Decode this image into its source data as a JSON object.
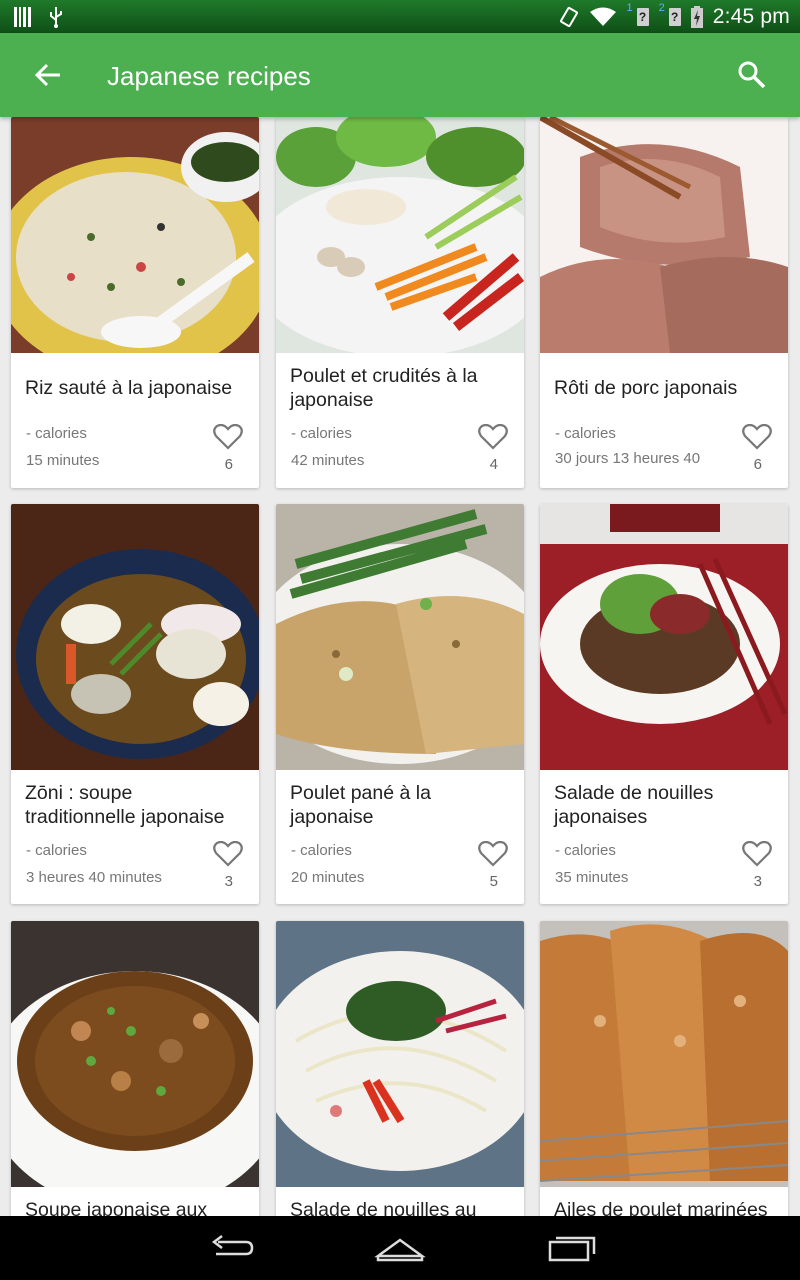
{
  "status_bar": {
    "time": "2:45 pm",
    "sim1": "1",
    "sim2": "2",
    "unknown_glyph": "?",
    "icons": [
      "barcode-icon",
      "usb-icon",
      "rotate-icon",
      "wifi-icon",
      "signal-icon",
      "battery-charging-icon"
    ]
  },
  "toolbar": {
    "title": "Japanese recipes",
    "back_icon": "arrow-back-icon",
    "search_icon": "search-icon",
    "color": "#4caf50"
  },
  "recipes": [
    {
      "title": "Riz sauté à la japonaise",
      "calories": "- calories",
      "time": "15 minutes",
      "likes": "6"
    },
    {
      "title": "Poulet et crudités à la japonaise",
      "calories": "- calories",
      "time": "42 minutes",
      "likes": "4"
    },
    {
      "title": "Rôti de porc japonais",
      "calories": "- calories",
      "time": "30 jours 13 heures 40",
      "likes": "6"
    },
    {
      "title": "Zōni : soupe traditionnelle japonaise",
      "calories": "- calories",
      "time": "3 heures 40 minutes",
      "likes": "3"
    },
    {
      "title": "Poulet pané à la japonaise",
      "calories": "- calories",
      "time": "20 minutes",
      "likes": "5"
    },
    {
      "title": "Salade de nouilles japonaises",
      "calories": "- calories",
      "time": "35 minutes",
      "likes": "3"
    },
    {
      "title": "Soupe japonaise aux"
    },
    {
      "title": "Salade de nouilles au"
    },
    {
      "title": "Ailes de poulet marinées"
    }
  ],
  "nav_bar": {
    "icons": [
      "back-nav-icon",
      "home-nav-icon",
      "recents-nav-icon"
    ]
  }
}
